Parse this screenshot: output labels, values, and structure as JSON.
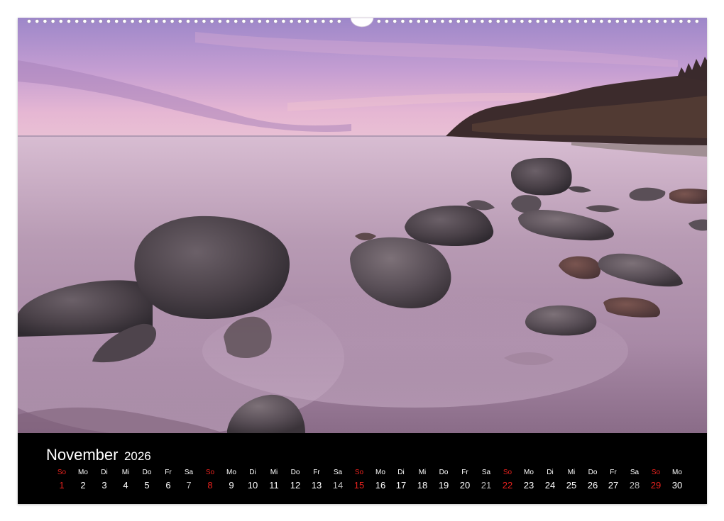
{
  "calendar": {
    "month": "November",
    "year": "2026",
    "days": [
      {
        "weekday": "So",
        "day": "1",
        "sunday": true
      },
      {
        "weekday": "Mo",
        "day": "2"
      },
      {
        "weekday": "Di",
        "day": "3"
      },
      {
        "weekday": "Mi",
        "day": "4"
      },
      {
        "weekday": "Do",
        "day": "5"
      },
      {
        "weekday": "Fr",
        "day": "6"
      },
      {
        "weekday": "Sa",
        "day": "7",
        "saturday": true
      },
      {
        "weekday": "So",
        "day": "8",
        "sunday": true
      },
      {
        "weekday": "Mo",
        "day": "9"
      },
      {
        "weekday": "Di",
        "day": "10"
      },
      {
        "weekday": "Mi",
        "day": "11"
      },
      {
        "weekday": "Do",
        "day": "12"
      },
      {
        "weekday": "Fr",
        "day": "13"
      },
      {
        "weekday": "Sa",
        "day": "14",
        "saturday": true
      },
      {
        "weekday": "So",
        "day": "15",
        "sunday": true
      },
      {
        "weekday": "Mo",
        "day": "16"
      },
      {
        "weekday": "Di",
        "day": "17"
      },
      {
        "weekday": "Mi",
        "day": "18"
      },
      {
        "weekday": "Do",
        "day": "19"
      },
      {
        "weekday": "Fr",
        "day": "20"
      },
      {
        "weekday": "Sa",
        "day": "21",
        "saturday": true
      },
      {
        "weekday": "So",
        "day": "22",
        "sunday": true
      },
      {
        "weekday": "Mo",
        "day": "23"
      },
      {
        "weekday": "Di",
        "day": "24"
      },
      {
        "weekday": "Mi",
        "day": "25"
      },
      {
        "weekday": "Do",
        "day": "26"
      },
      {
        "weekday": "Fr",
        "day": "27"
      },
      {
        "weekday": "Sa",
        "day": "28",
        "saturday": true
      },
      {
        "weekday": "So",
        "day": "29",
        "sunday": true
      },
      {
        "weekday": "Mo",
        "day": "30"
      }
    ]
  },
  "colors": {
    "sunday": "#e8221e",
    "saturday": "#bdbdbd",
    "weekday": "#ffffff",
    "calendar_background": "#000000"
  }
}
